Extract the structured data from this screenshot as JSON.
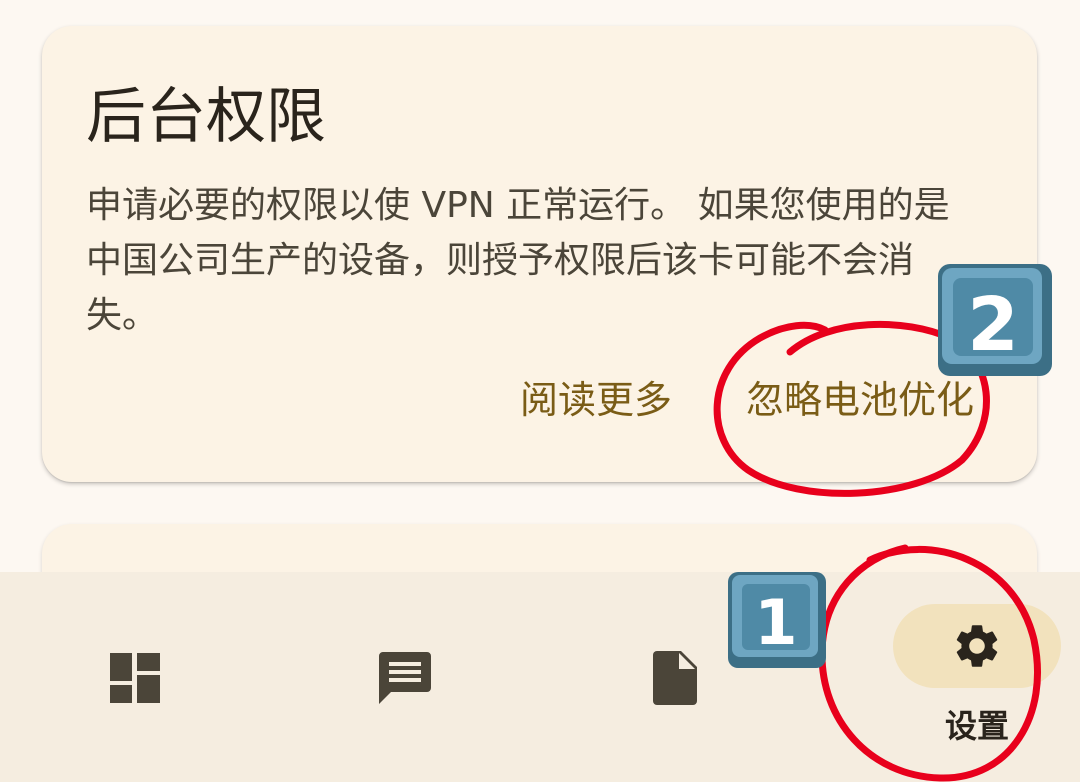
{
  "card": {
    "title": "后台权限",
    "description": "申请必要的权限以使 VPN 正常运行。 如果您使用的是中国公司生产的设备，则授予权限后该卡可能不会消失。",
    "actions": {
      "read_more": "阅读更多",
      "ignore_battery": "忽略电池优化"
    }
  },
  "bottom_nav": {
    "items": [
      {
        "icon": "dashboard-icon",
        "label": ""
      },
      {
        "icon": "message-icon",
        "label": ""
      },
      {
        "icon": "document-icon",
        "label": ""
      },
      {
        "icon": "gear-icon",
        "label": "设置",
        "selected": true
      }
    ]
  },
  "annotations": {
    "badge_1": "1",
    "badge_2": "2",
    "circle_color": "#e8001c",
    "badge_color": "#4f8aa6"
  },
  "colors": {
    "card_bg": "#fcf3e5",
    "accent_text": "#7a5c16",
    "nav_pill": "#f2e2bd"
  }
}
